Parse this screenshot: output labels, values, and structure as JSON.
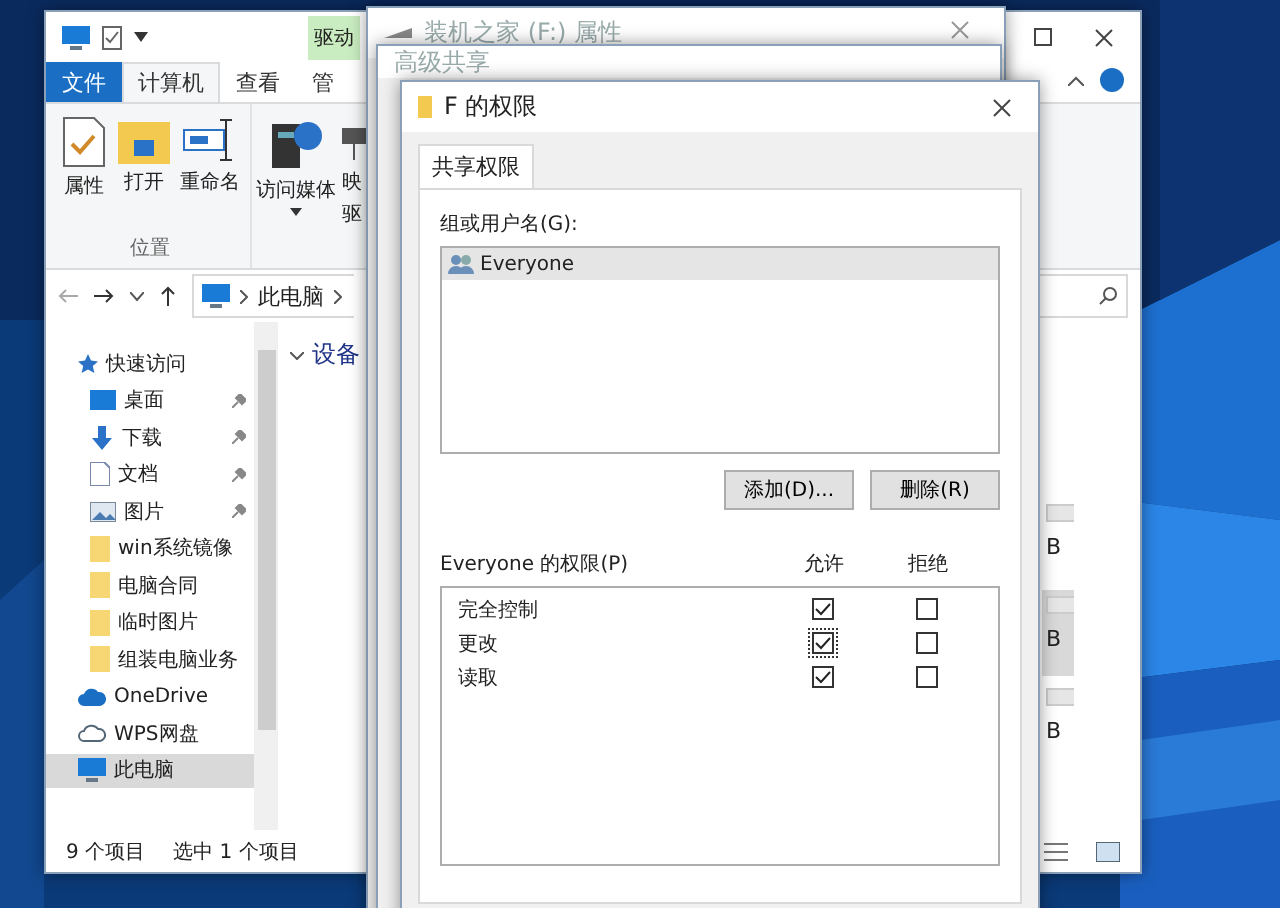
{
  "explorer": {
    "context_tab": "驱动",
    "ribbon_tabs": [
      {
        "label": "文件",
        "kind": "file",
        "selected": false
      },
      {
        "label": "计算机",
        "kind": "tab",
        "selected": true
      },
      {
        "label": "查看",
        "kind": "tab",
        "selected": false
      },
      {
        "label": "管",
        "kind": "tab",
        "selected": false
      }
    ],
    "ribbon_buttons": [
      {
        "label": "属性",
        "kind": "properties"
      },
      {
        "label": "打开",
        "kind": "open"
      },
      {
        "label": "重命名",
        "kind": "rename"
      },
      {
        "label": "访问媒体",
        "kind": "media",
        "dropdown": true
      },
      {
        "label": "映",
        "label_2": "驱",
        "kind": "map"
      }
    ],
    "group_label": "位置",
    "address_path": [
      "此电脑"
    ],
    "nav_items": [
      {
        "label": "快速访问",
        "kind": "star",
        "pinned": false,
        "selected": false
      },
      {
        "label": "桌面",
        "kind": "desktop",
        "pinned": true,
        "selected": false
      },
      {
        "label": "下载",
        "kind": "download",
        "pinned": true,
        "selected": false
      },
      {
        "label": "文档",
        "kind": "document",
        "pinned": true,
        "selected": false
      },
      {
        "label": "图片",
        "kind": "pictures",
        "pinned": true,
        "selected": false
      },
      {
        "label": "win系统镜像",
        "kind": "folder",
        "pinned": false,
        "selected": false
      },
      {
        "label": "电脑合同",
        "kind": "folder",
        "pinned": false,
        "selected": false
      },
      {
        "label": "临时图片",
        "kind": "folder",
        "pinned": false,
        "selected": false
      },
      {
        "label": "组装电脑业务",
        "kind": "folder",
        "pinned": false,
        "selected": false
      },
      {
        "label": "OneDrive",
        "kind": "cloud",
        "pinned": false,
        "selected": false
      },
      {
        "label": "WPS网盘",
        "kind": "cloud-outline",
        "pinned": false,
        "selected": false
      },
      {
        "label": "此电脑",
        "kind": "computer",
        "pinned": false,
        "selected": true
      }
    ],
    "content_heading": "设备",
    "drives": [
      {
        "size": "B",
        "selected": false
      },
      {
        "size": "B",
        "selected": true
      },
      {
        "size": "B",
        "selected": false
      }
    ],
    "status": [
      "9 个项目",
      "选中 1 个项目"
    ]
  },
  "properties_window": {
    "title": "装机之家 (F:) 属性"
  },
  "advanced_sharing": {
    "title": "高级共享"
  },
  "permissions_dialog": {
    "title": "F 的权限",
    "tabs": [
      {
        "label": "共享权限",
        "selected": true
      }
    ],
    "group_label": "组或用户名(G):",
    "users": [
      {
        "name": "Everyone",
        "selected": true
      }
    ],
    "buttons": [
      "添加(D)...",
      "删除(R)"
    ],
    "permissions_label": "Everyone 的权限(P)",
    "columns": [
      "允许",
      "拒绝"
    ],
    "permissions": [
      {
        "name": "完全控制",
        "allow": true,
        "deny": false,
        "focused": false
      },
      {
        "name": "更改",
        "allow": true,
        "deny": false,
        "focused": true
      },
      {
        "name": "读取",
        "allow": true,
        "deny": false,
        "focused": false
      }
    ]
  }
}
